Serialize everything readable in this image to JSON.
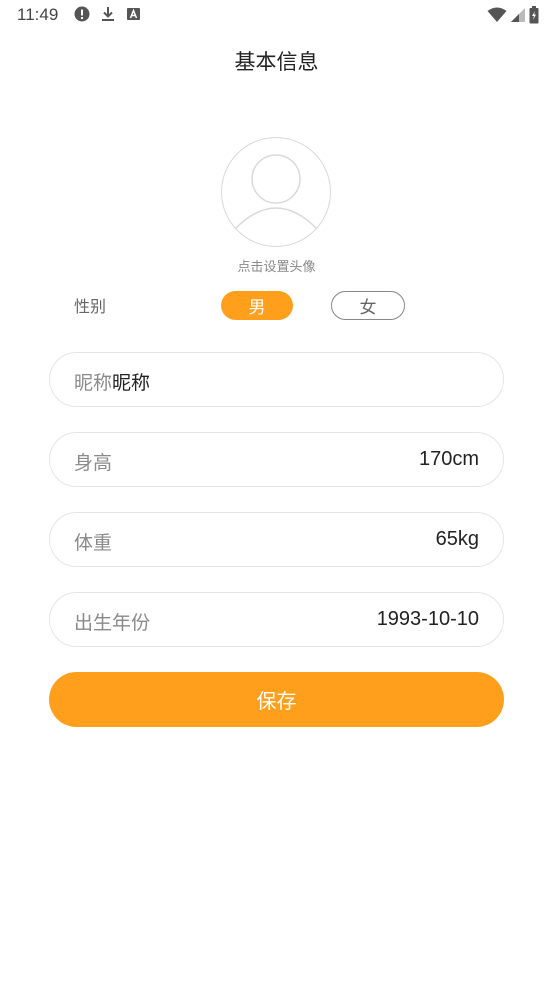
{
  "status_bar": {
    "time": "11:49",
    "icons_left": [
      "alert-icon",
      "download-icon",
      "a-icon"
    ],
    "icons_right": [
      "wifi-icon",
      "signal-icon",
      "battery-icon"
    ]
  },
  "header": {
    "title": "基本信息"
  },
  "avatar": {
    "hint": "点击设置头像"
  },
  "gender": {
    "label": "性别",
    "options": [
      "男",
      "女"
    ],
    "selected": "男"
  },
  "fields": {
    "nickname": {
      "placeholder": "昵称",
      "value": "昵称"
    },
    "height": {
      "label": "身高",
      "value": "170cm"
    },
    "weight": {
      "label": "体重",
      "value": "65kg"
    },
    "birth": {
      "label": "出生年份",
      "value": "1993-10-10"
    }
  },
  "actions": {
    "save_label": "保存"
  },
  "colors": {
    "accent": "#ff9f1c"
  }
}
